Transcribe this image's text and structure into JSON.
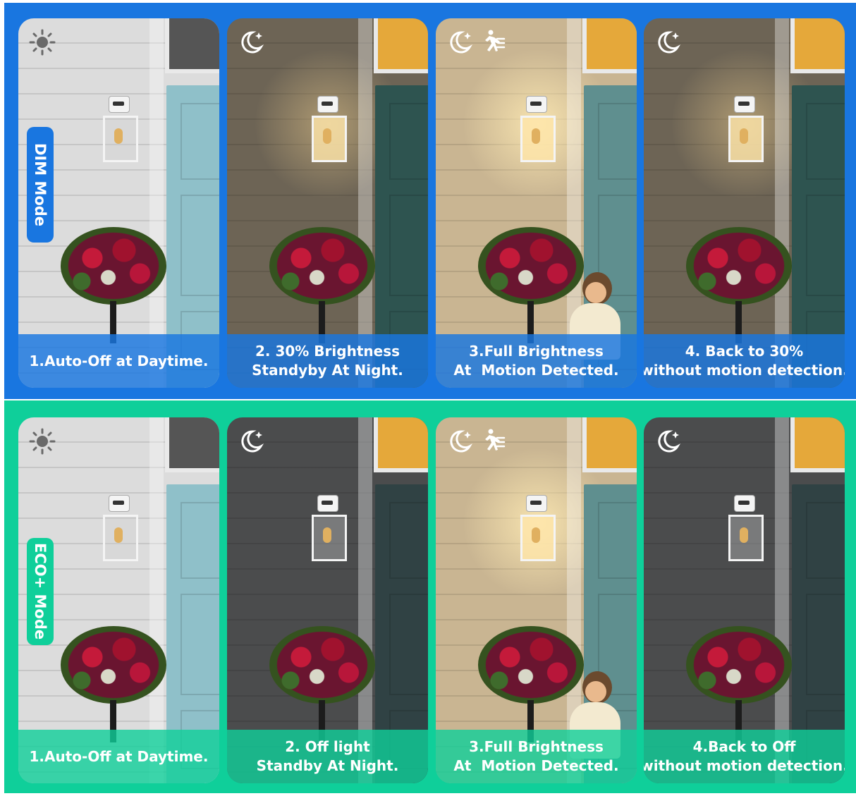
{
  "colors": {
    "dim_band": "#1976e0",
    "eco_band": "#0fcf9a",
    "caption_text": "#ffffff"
  },
  "rows": [
    {
      "mode_label": "DIM Mode",
      "panels": [
        {
          "icons": [
            "sun-icon"
          ],
          "caption": [
            "1.Auto-Off at Daytime."
          ],
          "scene": "day"
        },
        {
          "icons": [
            "moon-icon"
          ],
          "caption": [
            "2. 30% Brightness",
            "Standyby At Night."
          ],
          "scene": "dim"
        },
        {
          "icons": [
            "moon-icon",
            "motion-icon"
          ],
          "caption": [
            "3.Full Brightness",
            "At  Motion Detected."
          ],
          "scene": "bright"
        },
        {
          "icons": [
            "moon-icon"
          ],
          "caption": [
            "4. Back to 30%",
            "without motion detection."
          ],
          "scene": "dim"
        }
      ]
    },
    {
      "mode_label": "ECO+ Mode",
      "panels": [
        {
          "icons": [
            "sun-icon"
          ],
          "caption": [
            "1.Auto-Off at Daytime."
          ],
          "scene": "day"
        },
        {
          "icons": [
            "moon-icon"
          ],
          "caption": [
            "2. Off light",
            "Standby At Night."
          ],
          "scene": "off"
        },
        {
          "icons": [
            "moon-icon",
            "motion-icon"
          ],
          "caption": [
            "3.Full Brightness",
            "At  Motion Detected."
          ],
          "scene": "bright"
        },
        {
          "icons": [
            "moon-icon"
          ],
          "caption": [
            "4.Back to Off",
            "without motion detection."
          ],
          "scene": "off"
        }
      ]
    }
  ]
}
